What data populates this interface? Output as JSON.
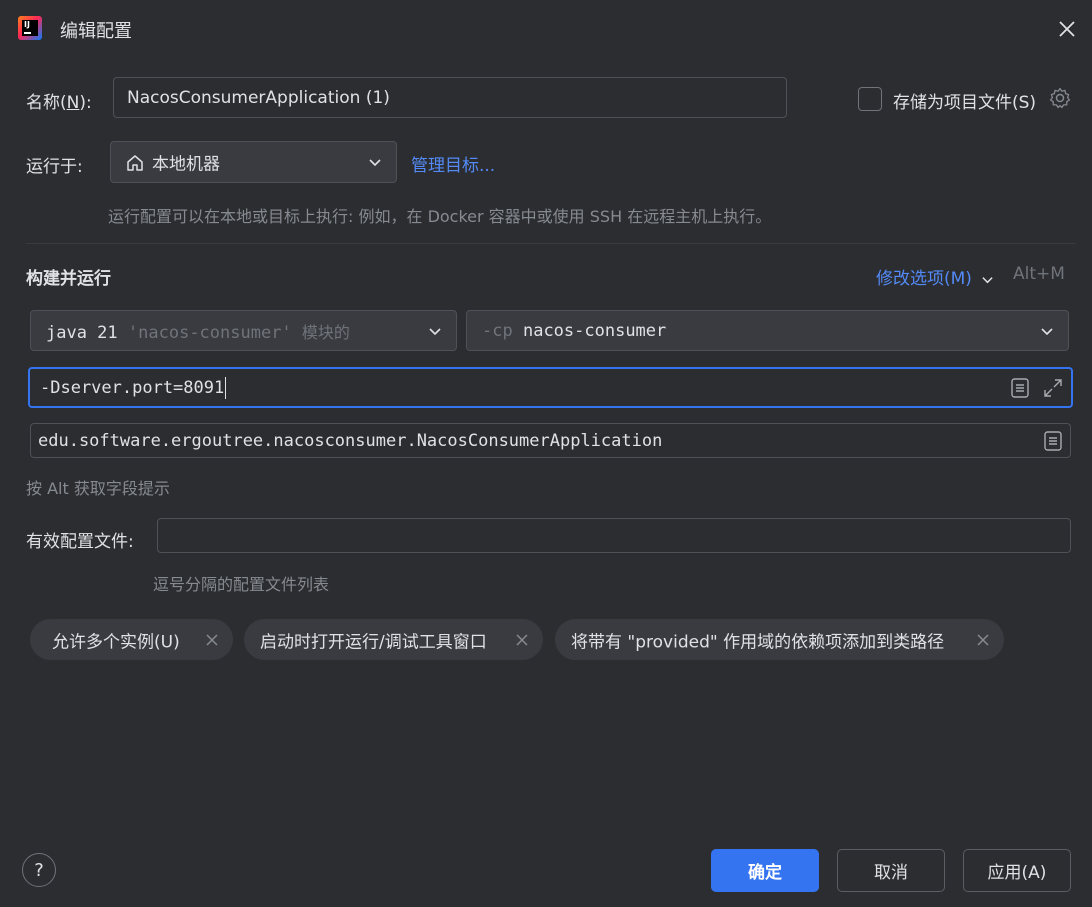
{
  "window": {
    "title": "编辑配置",
    "close_icon": "close-icon",
    "app_icon": "intellij-idea-icon"
  },
  "name_row": {
    "label_prefix": "名称(",
    "label_mnemonic": "N",
    "label_suffix": "):",
    "value": "NacosConsumerApplication (1)",
    "store_checkbox_label": "存储为项目文件(S)",
    "store_checked": false
  },
  "run_on": {
    "label": "运行于:",
    "target": "本地机器",
    "target_icon": "home-icon",
    "manage_link": "管理目标...",
    "hint": "运行配置可以在本地或目标上执行: 例如，在 Docker 容器中或使用 SSH 在远程主机上执行。"
  },
  "build_run": {
    "section_title": "构建并运行",
    "modify_options": "修改选项(M)",
    "shortcut": "Alt+M",
    "jdk": {
      "main": "java 21",
      "module": "'nacos-consumer'",
      "suffix": "模块的"
    },
    "classpath": {
      "flag": "-cp",
      "value": "nacos-consumer"
    },
    "vm_options": "-Dserver.port=8091",
    "main_class": "edu.software.ergoutree.nacosconsumer.NacosConsumerApplication",
    "alt_hint": "按 Alt 获取字段提示"
  },
  "profiles": {
    "label": "有效配置文件:",
    "value": "",
    "hint": "逗号分隔的配置文件列表"
  },
  "chips": [
    {
      "label": "允许多个实例(U)"
    },
    {
      "label": "启动时打开运行/调试工具窗口"
    },
    {
      "label": "将带有 \"provided\" 作用域的依赖项添加到类路径"
    }
  ],
  "buttons": {
    "ok": "确定",
    "cancel": "取消",
    "apply": "应用(A)",
    "help": "?"
  },
  "colors": {
    "background": "#2b2d30",
    "accent": "#3574f0",
    "link": "#548af7",
    "focus": "#3574f0"
  }
}
